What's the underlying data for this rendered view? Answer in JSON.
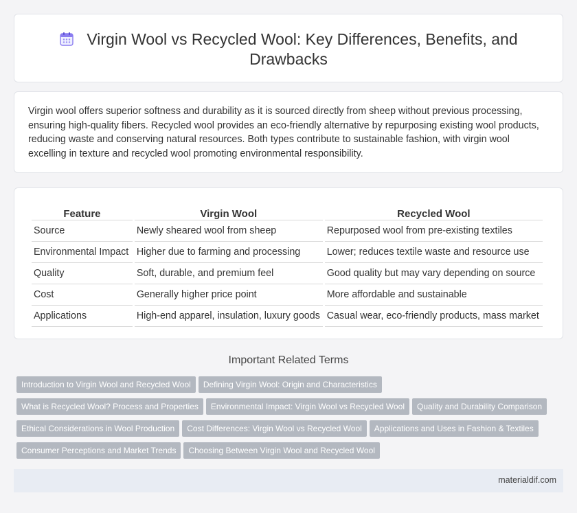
{
  "header": {
    "title": "Virgin Wool vs Recycled Wool: Key Differences, Benefits, and Drawbacks",
    "icon": "calendar-icon",
    "accent": "#7b68ee"
  },
  "intro": {
    "text": "Virgin wool offers superior softness and durability as it is sourced directly from sheep without previous processing, ensuring high-quality fibers. Recycled wool provides an eco-friendly alternative by repurposing existing wool products, reducing waste and conserving natural resources. Both types contribute to sustainable fashion, with virgin wool excelling in texture and recycled wool promoting environmental responsibility."
  },
  "table": {
    "headers": [
      "Feature",
      "Virgin Wool",
      "Recycled Wool"
    ],
    "rows": [
      [
        "Source",
        "Newly sheared wool from sheep",
        "Repurposed wool from pre-existing textiles"
      ],
      [
        "Environmental Impact",
        "Higher due to farming and processing",
        "Lower; reduces textile waste and resource use"
      ],
      [
        "Quality",
        "Soft, durable, and premium feel",
        "Good quality but may vary depending on source"
      ],
      [
        "Cost",
        "Generally higher price point",
        "More affordable and sustainable"
      ],
      [
        "Applications",
        "High-end apparel, insulation, luxury goods",
        "Casual wear, eco-friendly products, mass market"
      ]
    ]
  },
  "related": {
    "title": "Important Related Terms",
    "rows": [
      [
        "Introduction to Virgin Wool and Recycled Wool",
        "Defining Virgin Wool: Origin and Characteristics"
      ],
      [
        "What is Recycled Wool? Process and Properties",
        "Environmental Impact: Virgin Wool vs Recycled Wool",
        "Quality and Durability Comparison"
      ],
      [
        "Ethical Considerations in Wool Production",
        "Cost Differences: Virgin Wool vs Recycled Wool",
        "Applications and Uses in Fashion & Textiles"
      ],
      [
        "Consumer Perceptions and Market Trends",
        "Choosing Between Virgin Wool and Recycled Wool"
      ]
    ]
  },
  "footer": {
    "site": "materialdif.com"
  }
}
